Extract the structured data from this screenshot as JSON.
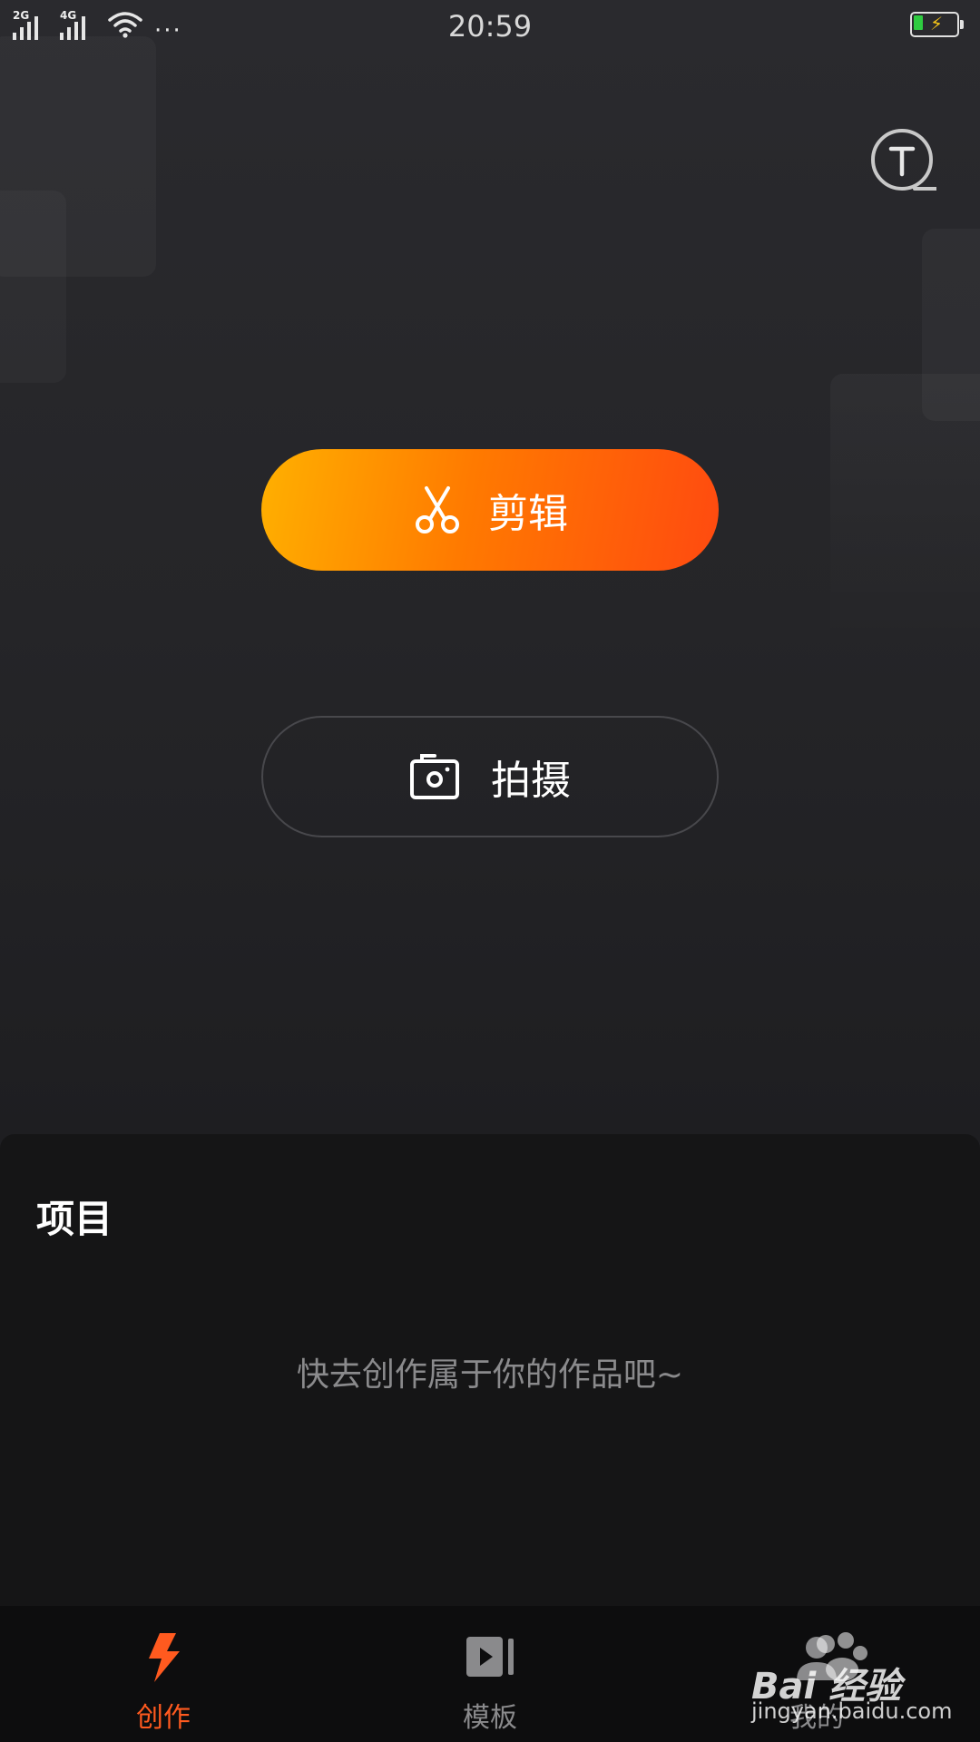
{
  "status_bar": {
    "time": "20:59",
    "networks": [
      "2G",
      "4G"
    ],
    "more": "···",
    "icons": [
      "signal-2g-icon",
      "signal-4g-icon",
      "wifi-icon",
      "battery-charging-icon"
    ]
  },
  "actions": {
    "edit_label": "剪辑",
    "edit_icon": "scissors-icon",
    "shoot_label": "拍摄",
    "shoot_icon": "camera-icon",
    "text_tool_icon": "text-search-icon"
  },
  "projects": {
    "title": "项目",
    "empty_message": "快去创作属于你的作品吧~"
  },
  "tabs": [
    {
      "label": "创作",
      "icon": "lightning-icon",
      "active": true
    },
    {
      "label": "模板",
      "icon": "video-template-icon",
      "active": false
    },
    {
      "label": "我的",
      "icon": "profile-icon",
      "active": false
    }
  ],
  "watermark": {
    "brand": "Bai 经验",
    "url": "jingyan.baidu.com"
  },
  "colors": {
    "accent": "#ff5a1f",
    "gradient_start": "#ffb000",
    "gradient_end": "#ff4a10",
    "background": "#252528",
    "panel": "#151516"
  }
}
